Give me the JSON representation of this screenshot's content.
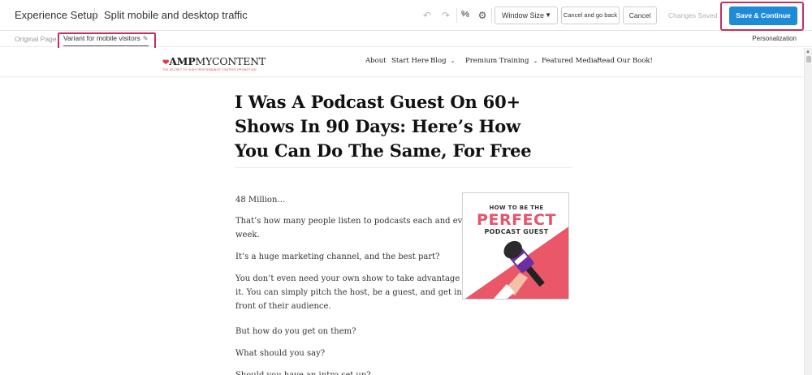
{
  "header": {
    "app_title": "Experience Setup",
    "experience_name": "Split mobile and desktop traffic",
    "undo_icon": "undo-icon",
    "redo_icon": "redo-icon",
    "settings_icon": "gear-icon",
    "window_size_label": "Window Size",
    "cancel_and_go_back_label": "Cancel and go back",
    "cancel_label": "Cancel",
    "changes_saved_label": "Changes Saved",
    "save_continue_label": "Save & Continue",
    "accent_color": "#1f8bd6",
    "highlight_color": "#c5305c"
  },
  "variant_bar": {
    "tabs": [
      {
        "label": "Original Page",
        "selected": false
      },
      {
        "label": "Variant for mobile visitors",
        "selected": true
      }
    ],
    "personalization_label": "Personalization"
  },
  "site": {
    "logo_text_amp": "AMP",
    "logo_text_rest": "MYCONTENT",
    "logo_tagline": "THE SECRET TO HIGH PERFORMANCE CONTENT PROMOTION",
    "nav": [
      {
        "label": "About"
      },
      {
        "label": "Start Here"
      },
      {
        "label": "Blog"
      },
      {
        "label": "Premium Training"
      },
      {
        "label": "Featured Media"
      },
      {
        "label": "Read Our Book!"
      }
    ]
  },
  "article": {
    "title_lines": [
      "I Was A Podcast Guest On 60+",
      "Shows In 90 Days: Here’s How",
      "You Can Do The Same, For Free"
    ],
    "paragraphs": [
      "48 Million…",
      "That’s how many people listen to podcasts each and every",
      "week.",
      "It’s a huge marketing channel, and the best part?",
      "You don’t even need your own show to take advantage of",
      "it. You can simply pitch the host, be a guest, and get in",
      "front of their audience.",
      "But how do you get on them?",
      "What should you say?",
      "Should you have an intro set up?"
    ],
    "image": {
      "line1": "HOW TO BE THE",
      "line2": "PERFECT",
      "line3": "PODCAST GUEST",
      "pink": "#ea5769",
      "mic_color": "#6a2fa0"
    }
  }
}
